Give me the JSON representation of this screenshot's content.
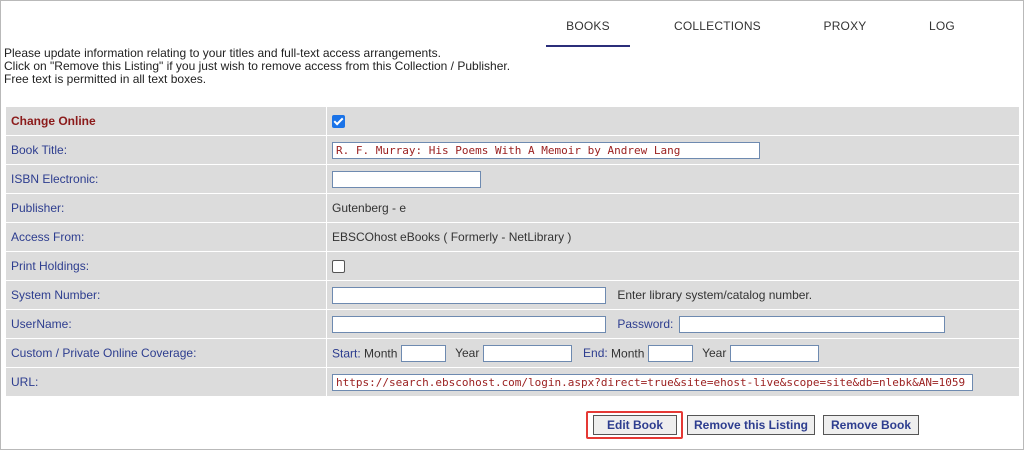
{
  "nav": {
    "tabs": [
      "BOOKS",
      "COLLECTIONS",
      "PROXY",
      "LOG"
    ],
    "active": "BOOKS"
  },
  "intro": [
    "Please update information relating to your titles and full-text access arrangements.",
    "Click on \"Remove this Listing\" if you just wish to remove access from this Collection / Publisher.",
    "Free text is permitted in all text boxes."
  ],
  "form": {
    "change_online": {
      "label": "Change Online",
      "checked": true
    },
    "book_title": {
      "label": "Book Title:",
      "value": "R. F. Murray: His Poems With A Memoir by Andrew Lang"
    },
    "isbn": {
      "label": "ISBN Electronic:",
      "value": ""
    },
    "publisher": {
      "label": "Publisher:",
      "value": "Gutenberg - e"
    },
    "access_from": {
      "label": "Access From:",
      "value": "EBSCOhost eBooks ( Formerly - NetLibrary )"
    },
    "print_holdings": {
      "label": "Print Holdings:",
      "checked": false
    },
    "system_number": {
      "label": "System Number:",
      "value": "",
      "hint": "Enter library system/catalog number."
    },
    "username": {
      "label": "UserName:",
      "value": "",
      "password_label": "Password:",
      "password_value": ""
    },
    "coverage": {
      "label": "Custom / Private Online Coverage:",
      "start_label": "Start:",
      "month_label": "Month",
      "year_label": "Year",
      "end_label": "End:"
    },
    "url": {
      "label": "URL:",
      "value": "https://search.ebscohost.com/login.aspx?direct=true&site=ehost-live&scope=site&db=nlebk&AN=1059"
    }
  },
  "buttons": {
    "edit": "Edit Book",
    "remove_listing": "Remove this Listing",
    "remove_book": "Remove Book"
  },
  "colors": {
    "label_blue": "#2d3d8f",
    "label_red": "#8b1a1a",
    "row_bg": "#dcdcdc",
    "highlight": "#e53935",
    "nav_underline": "#2b2e7a"
  }
}
